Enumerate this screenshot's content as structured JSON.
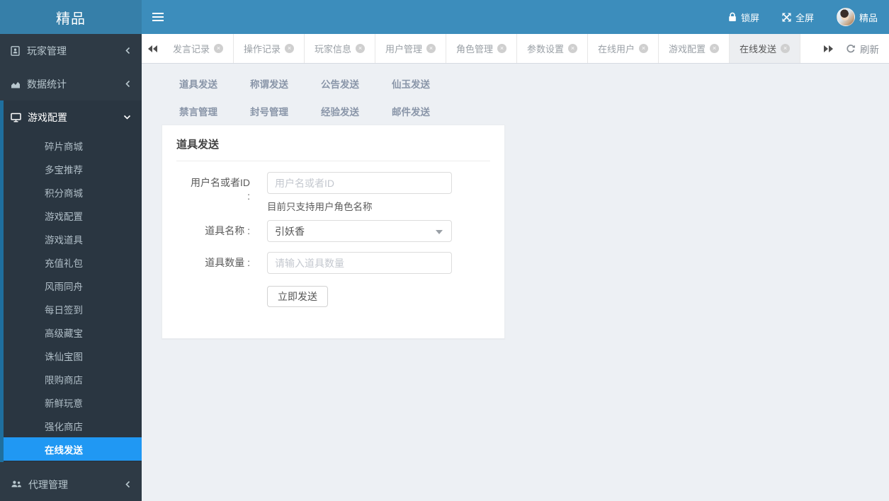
{
  "brand": {
    "logo_text": "精品",
    "user_name": "精品"
  },
  "topbar": {
    "lock_label": "锁屏",
    "fullscreen_label": "全屏"
  },
  "sidebar": {
    "sections": [
      {
        "label": "玩家管理",
        "icon": "address-book-icon",
        "state": "collapsed"
      },
      {
        "label": "数据统计",
        "icon": "chart-area-icon",
        "state": "collapsed"
      },
      {
        "label": "游戏配置",
        "icon": "monitor-icon",
        "state": "expanded",
        "children": [
          "碎片商城",
          "多宝推荐",
          "积分商城",
          "游戏配置",
          "游戏道具",
          "充值礼包",
          "风雨同舟",
          "每日签到",
          "高级藏宝",
          "诛仙宝图",
          "限购商店",
          "新鲜玩意",
          "强化商店",
          "在线发送"
        ],
        "active_child": "在线发送"
      },
      {
        "label": "代理管理",
        "icon": "users-icon",
        "state": "collapsed"
      }
    ]
  },
  "tabbar": {
    "tabs": [
      "发言记录",
      "操作记录",
      "玩家信息",
      "用户管理",
      "角色管理",
      "参数设置",
      "在线用户",
      "游戏配置",
      "在线发送"
    ],
    "active_tab": "在线发送",
    "refresh_label": "刷新"
  },
  "subnav": {
    "rows": [
      [
        "道具发送",
        "称谓发送",
        "公告发送",
        "仙玉发送"
      ],
      [
        "禁言管理",
        "封号管理",
        "经验发送",
        "邮件发送"
      ]
    ],
    "active": "道具发送"
  },
  "panel": {
    "title": "道具发送",
    "form": {
      "username_label": "用户名或者ID :",
      "username_placeholder": "用户名或者ID",
      "username_help": "目前只支持用户角色名称",
      "item_label": "道具名称 :",
      "item_value": "引妖香",
      "quantity_label": "道具数量 :",
      "quantity_placeholder": "请输入道具数量",
      "submit_label": "立即发送"
    }
  },
  "colors": {
    "navbar": "#3c8dbc",
    "logo_bg": "#367fa9",
    "sidebar_bg": "#2e3a45",
    "active_item": "#2098f3",
    "treeview_strip": "#1f6f9e",
    "content_bg": "#edf0f4"
  }
}
